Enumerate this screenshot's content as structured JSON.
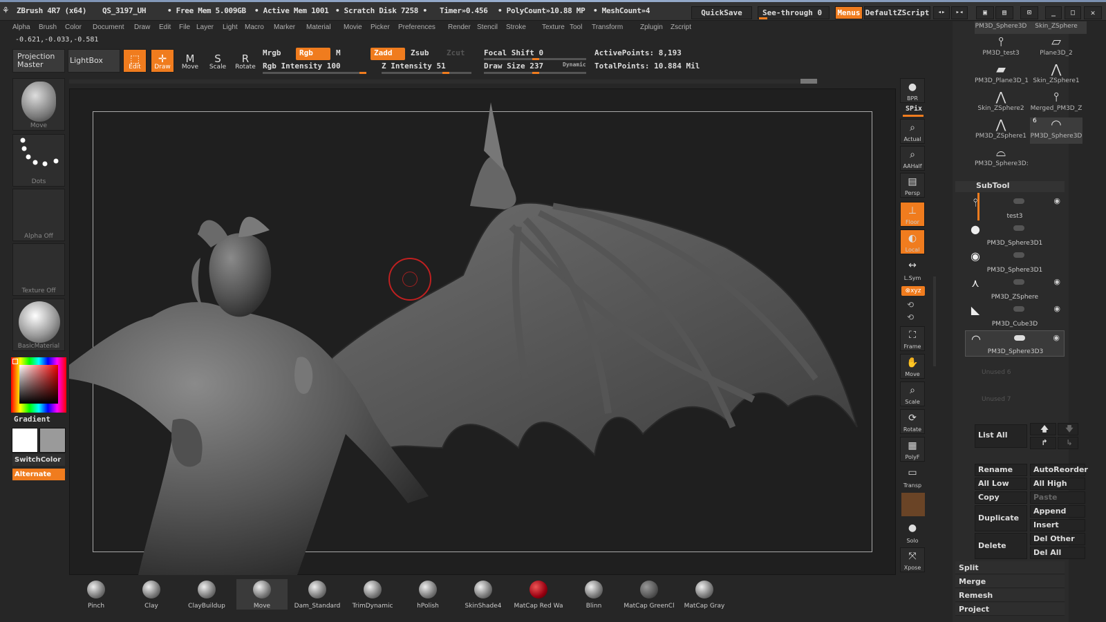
{
  "titlebar": {
    "app": "ZBrush 4R7 (x64)",
    "file": "QS_3197_UH",
    "free_mem": "• Free Mem 5.009GB",
    "active_mem": "• Active Mem 1001",
    "scratch": "• Scratch Disk 7258 •",
    "timer": "Timer»0.456",
    "polycount": "• PolyCount»10.88 MP",
    "meshcount": "• MeshCount»4",
    "quicksave": "QuickSave",
    "see_through": "See-through   0",
    "menus": "Menus",
    "script": "DefaultZScript"
  },
  "menubar": [
    "Alpha",
    "Brush",
    "Color",
    "Document",
    "Draw",
    "Edit",
    "File",
    "Layer",
    "Light",
    "Macro",
    "Marker",
    "Material",
    "Movie",
    "Picker",
    "Preferences",
    "Render",
    "Stencil",
    "Stroke",
    "Texture",
    "Tool",
    "Transform",
    "Zplugin",
    "Zscript"
  ],
  "coords": "-0.621,-0.033,-0.581",
  "toolbar": {
    "projection_master": "Projection Master",
    "lightbox": "LightBox",
    "edit": "Edit",
    "draw": "Draw",
    "move": "Move",
    "scale": "Scale",
    "rotate": "Rotate",
    "mrgb": "Mrgb",
    "rgb": "Rgb",
    "m": "M",
    "zadd": "Zadd",
    "zsub": "Zsub",
    "zcut": "Zcut",
    "rgb_intensity": "Rgb Intensity 100",
    "z_intensity": "Z Intensity 51",
    "focal_shift": "Focal Shift 0",
    "draw_size": "Draw Size 237",
    "dynamic": "Dynamic",
    "active_points": "ActivePoints: 8,193",
    "total_points": "TotalPoints: 10.884 Mil",
    "rgb_intensity_value": 100,
    "z_intensity_value": 51,
    "focal_shift_value": 0,
    "draw_size_value": 237
  },
  "left_shelf": {
    "move": "Move",
    "dots": "Dots",
    "alpha_off": "Alpha  Off",
    "texture_off": "Texture  Off",
    "basic_material": "BasicMaterial",
    "gradient": "Gradient",
    "switch_color": "SwitchColor",
    "alternate": "Alternate"
  },
  "right_tools": [
    "BPR",
    "SPix",
    "Actual",
    "AAHalf",
    "Persp",
    "Floor",
    "Local",
    "L.Sym",
    "Frame",
    "Move",
    "Scale",
    "Rotate",
    "PolyF",
    "Transp",
    "Solo",
    "Xpose"
  ],
  "tool_palette": {
    "items": [
      "PM3D_Sphere3D",
      "Skin_ZSphere",
      "PM3D_test3",
      "Plane3D_2",
      "PM3D_Plane3D_1",
      "Skin_ZSphere1",
      "Skin_ZSphere2",
      "Merged_PM3D_Z",
      "PM3D_ZSphere1",
      "PM3D_Sphere3D",
      "PM3D_Sphere3D:"
    ],
    "badge": "6"
  },
  "subtool": {
    "title": "SubTool",
    "items": [
      "test3",
      "PM3D_Sphere3D1",
      "PM3D_Sphere3D1",
      "PM3D_ZSphere",
      "PM3D_Cube3D",
      "PM3D_Sphere3D3"
    ],
    "unused": [
      "Unused  6",
      "Unused  7"
    ],
    "list_all": "List  All",
    "rename": "Rename",
    "auto_reorder": "AutoReorder",
    "all_low": "All  Low",
    "all_high": "All  High",
    "copy": "Copy",
    "paste": "Paste",
    "append": "Append",
    "duplicate": "Duplicate",
    "insert": "Insert",
    "delete": "Delete",
    "del_other": "Del  Other",
    "del_all": "Del  All",
    "split": "Split",
    "merge": "Merge",
    "remesh": "Remesh",
    "project": "Project"
  },
  "brushes": [
    "Pinch",
    "Clay",
    "ClayBuildup",
    "Move",
    "Dam_Standard",
    "TrimDynamic",
    "hPolish",
    "SkinShade4",
    "MatCap  Red  Wa",
    "Blinn",
    "MatCap  GreenCl",
    "MatCap  Gray"
  ],
  "colors": {
    "accent": "#f07c1e",
    "background": "#262626",
    "canvas": "#1f1f1f"
  }
}
